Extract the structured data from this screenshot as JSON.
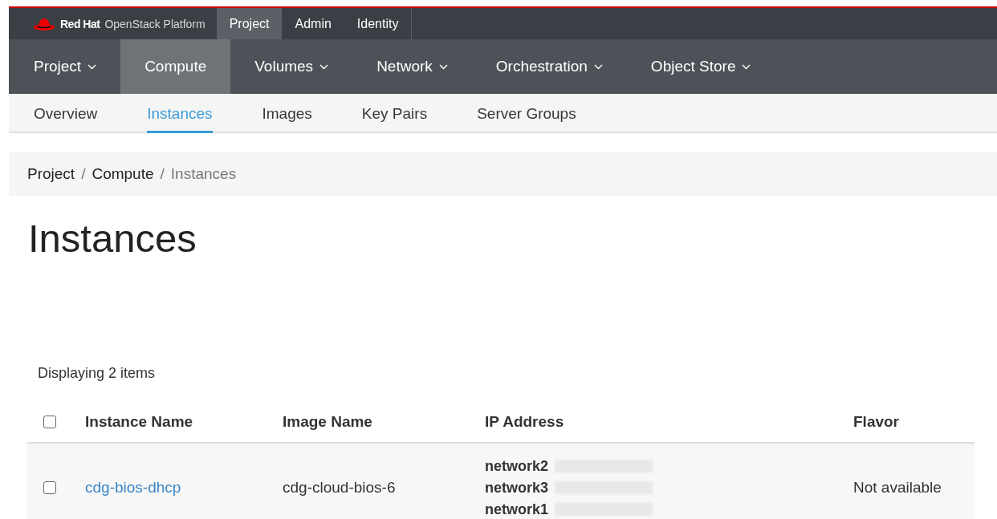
{
  "brand": {
    "name": "Red Hat",
    "product": "OpenStack Platform"
  },
  "top_tabs": [
    {
      "label": "Project",
      "selected": true
    },
    {
      "label": "Admin",
      "selected": false
    },
    {
      "label": "Identity",
      "selected": false
    }
  ],
  "nav": [
    {
      "label": "Project",
      "selected": false,
      "dropdown": true
    },
    {
      "label": "Compute",
      "selected": true,
      "dropdown": false
    },
    {
      "label": "Volumes",
      "selected": false,
      "dropdown": true
    },
    {
      "label": "Network",
      "selected": false,
      "dropdown": true
    },
    {
      "label": "Orchestration",
      "selected": false,
      "dropdown": true
    },
    {
      "label": "Object Store",
      "selected": false,
      "dropdown": true
    }
  ],
  "subnav": [
    {
      "label": "Overview",
      "selected": false
    },
    {
      "label": "Instances",
      "selected": true
    },
    {
      "label": "Images",
      "selected": false
    },
    {
      "label": "Key Pairs",
      "selected": false
    },
    {
      "label": "Server Groups",
      "selected": false
    }
  ],
  "breadcrumb": [
    "Project",
    "Compute",
    "Instances"
  ],
  "breadcrumb_separator": "/",
  "page_title": "Instances",
  "table": {
    "summary": "Displaying 2 items",
    "select_all_checked": false,
    "columns": [
      "Instance Name",
      "Image Name",
      "IP Address",
      "Flavor"
    ],
    "rows": [
      {
        "checked": false,
        "instance_name": "cdg-bios-dhcp",
        "image_name": "cdg-cloud-bios-6",
        "networks": [
          {
            "name": "network2",
            "redacted": true
          },
          {
            "name": "network3",
            "redacted": true
          },
          {
            "name": "network1",
            "redacted": true
          }
        ],
        "flavor": "Not available"
      }
    ]
  }
}
